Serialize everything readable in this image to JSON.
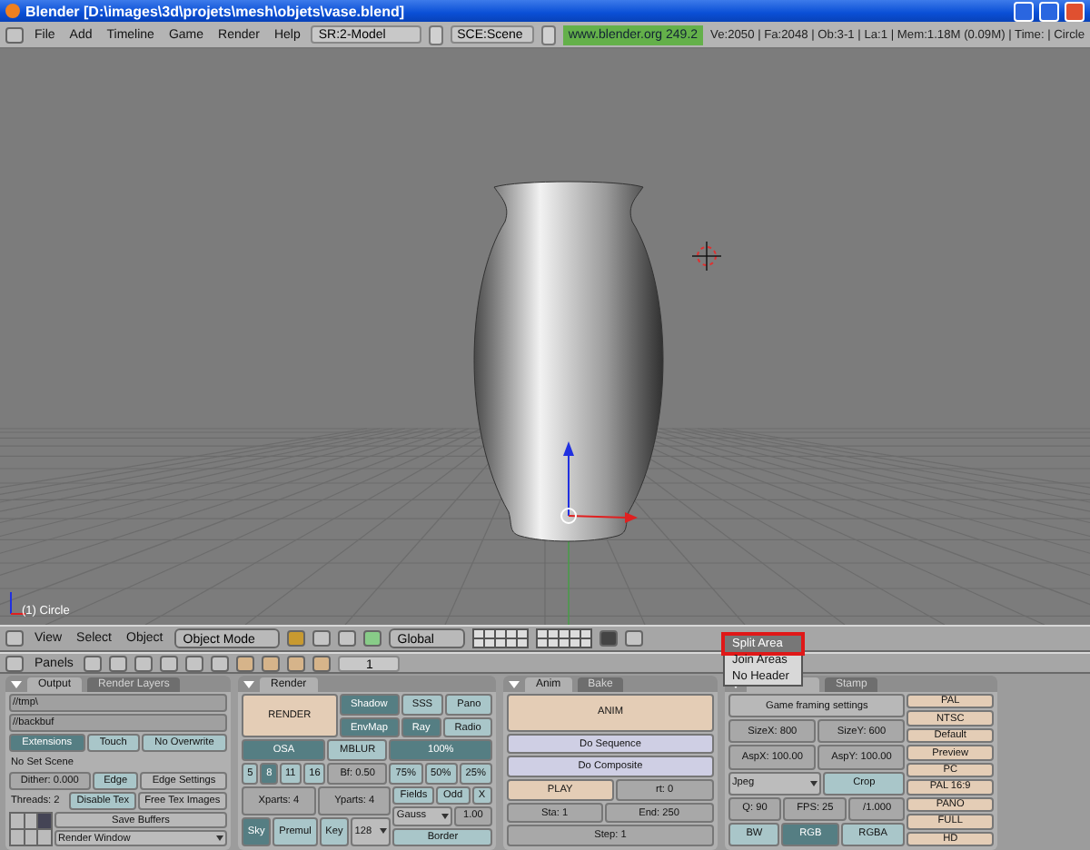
{
  "window": {
    "title": "Blender [D:\\images\\3d\\projets\\mesh\\objets\\vase.blend]"
  },
  "menu_bar": {
    "menus": [
      "File",
      "Add",
      "Timeline",
      "Game",
      "Render",
      "Help"
    ],
    "screen": "SR:2-Model",
    "scene": "SCE:Scene",
    "version": "www.blender.org 249.2",
    "stats": "Ve:2050 | Fa:2048 | Ob:3-1 | La:1 | Mem:1.18M (0.09M) | Time: | Circle"
  },
  "viewport": {
    "object_label": "(1) Circle"
  },
  "view_header": {
    "menus": [
      "View",
      "Select",
      "Object"
    ],
    "mode": "Object Mode",
    "orientation": "Global"
  },
  "buttons_header": {
    "label": "Panels",
    "frame": "1"
  },
  "context_menu": {
    "items": [
      {
        "label": "Split Area",
        "selected": true
      },
      {
        "label": "Join Areas",
        "selected": false
      },
      {
        "label": "No Header",
        "selected": false
      }
    ]
  },
  "panels": [
    {
      "tabs": [
        {
          "label": "Output",
          "selected": true
        },
        {
          "label": "Render Layers",
          "selected": false
        }
      ],
      "rows": [
        [
          {
            "kind": "field",
            "text": "//tmp\\"
          }
        ],
        [
          {
            "kind": "field",
            "text": "//backbuf"
          }
        ],
        [
          {
            "kind": "toggle",
            "text": "Extensions",
            "selected": true
          },
          {
            "kind": "toggle",
            "text": "Touch",
            "selected": false
          },
          {
            "kind": "toggle",
            "text": "No Overwrite",
            "selected": false
          }
        ],
        [
          {
            "kind": "label",
            "text": "No Set Scene"
          }
        ],
        [
          {
            "kind": "number",
            "text": "Dither: 0.000"
          },
          {
            "kind": "toggle",
            "text": "Edge",
            "selected": false
          },
          {
            "kind": "button",
            "text": "Edge Settings"
          }
        ],
        [
          {
            "kind": "label",
            "text": "Threads: 2"
          },
          {
            "kind": "toggle",
            "text": "Disable Tex",
            "selected": false
          },
          {
            "kind": "button",
            "text": "Free Tex Images"
          }
        ],
        [
          {
            "kind": "grid"
          },
          {
            "kind": "stack",
            "items": [
              {
                "kind": "button",
                "text": "Save Buffers"
              },
              {
                "kind": "menu",
                "text": "Render Window"
              }
            ]
          }
        ]
      ]
    },
    {
      "tabs": [
        {
          "label": "Render",
          "selected": true
        }
      ],
      "rows": [
        [
          {
            "kind": "big",
            "text": "RENDER"
          },
          {
            "kind": "stack",
            "items": [
              {
                "kind": "row",
                "items": [
                  {
                    "kind": "toggle",
                    "text": "Shadow",
                    "selected": true
                  },
                  {
                    "kind": "toggle",
                    "text": "SSS",
                    "selected": false
                  },
                  {
                    "kind": "toggle",
                    "text": "Pano",
                    "selected": false
                  }
                ]
              },
              {
                "kind": "row",
                "items": [
                  {
                    "kind": "toggle",
                    "text": "EnvMap",
                    "selected": true
                  },
                  {
                    "kind": "toggle",
                    "text": "Ray",
                    "selected": true
                  },
                  {
                    "kind": "toggle",
                    "text": "Radio",
                    "selected": false
                  }
                ]
              }
            ]
          }
        ],
        [
          {
            "kind": "stack",
            "items": [
              {
                "kind": "toggle",
                "text": "OSA",
                "selected": true
              },
              {
                "kind": "row",
                "items": [
                  {
                    "kind": "toggle",
                    "text": "5",
                    "selected": false
                  },
                  {
                    "kind": "toggle",
                    "text": "8",
                    "selected": true
                  },
                  {
                    "kind": "toggle",
                    "text": "11",
                    "selected": false
                  },
                  {
                    "kind": "toggle",
                    "text": "16",
                    "selected": false
                  }
                ]
              }
            ]
          },
          {
            "kind": "stack",
            "items": [
              {
                "kind": "toggle",
                "text": "MBLUR",
                "selected": false
              },
              {
                "kind": "number",
                "text": "Bf: 0.50"
              }
            ]
          },
          {
            "kind": "stack",
            "items": [
              {
                "kind": "toggle",
                "text": "100%",
                "selected": true
              },
              {
                "kind": "row",
                "items": [
                  {
                    "kind": "toggle",
                    "text": "75%",
                    "selected": false
                  },
                  {
                    "kind": "toggle",
                    "text": "50%",
                    "selected": false
                  },
                  {
                    "kind": "toggle",
                    "text": "25%",
                    "selected": false
                  }
                ]
              }
            ]
          }
        ],
        [
          {
            "kind": "stack",
            "items": [
              {
                "kind": "row",
                "items": [
                  {
                    "kind": "number",
                    "text": "Xparts: 4"
                  },
                  {
                    "kind": "number",
                    "text": "Yparts: 4"
                  }
                ]
              },
              {
                "kind": "row",
                "items": [
                  {
                    "kind": "toggle",
                    "text": "Sky",
                    "selected": true
                  },
                  {
                    "kind": "toggle",
                    "text": "Premul",
                    "selected": false
                  },
                  {
                    "kind": "toggle",
                    "text": "Key",
                    "selected": false
                  },
                  {
                    "kind": "menu",
                    "text": "128"
                  }
                ]
              }
            ]
          },
          {
            "kind": "stack",
            "items": [
              {
                "kind": "row",
                "items": [
                  {
                    "kind": "toggle",
                    "text": "Fields",
                    "selected": false
                  },
                  {
                    "kind": "toggle",
                    "text": "Odd",
                    "selected": false
                  },
                  {
                    "kind": "toggle",
                    "text": "X",
                    "selected": false
                  }
                ]
              },
              {
                "kind": "row",
                "items": [
                  {
                    "kind": "menu",
                    "text": "Gauss"
                  },
                  {
                    "kind": "number",
                    "text": "1.00"
                  }
                ]
              },
              {
                "kind": "toggle",
                "text": "Border",
                "selected": false
              }
            ]
          }
        ]
      ]
    },
    {
      "tabs": [
        {
          "label": "Anim",
          "selected": true
        },
        {
          "label": "Bake",
          "selected": false
        }
      ],
      "rows": [
        [
          {
            "kind": "big",
            "text": "ANIM"
          }
        ],
        [
          {
            "kind": "seq",
            "text": "Do Sequence"
          }
        ],
        [
          {
            "kind": "seq",
            "text": "Do Composite"
          }
        ],
        [
          {
            "kind": "action",
            "text": "PLAY"
          },
          {
            "kind": "number",
            "text": "rt: 0"
          }
        ],
        [
          {
            "kind": "number",
            "text": "Sta: 1"
          },
          {
            "kind": "number",
            "text": "End: 250"
          }
        ],
        [
          {
            "kind": "number",
            "text": "Step: 1"
          }
        ]
      ]
    },
    {
      "tabs": [
        {
          "label": "Stamp",
          "selected": false
        }
      ],
      "rows": [
        [
          {
            "kind": "stack",
            "items": [
              {
                "kind": "button",
                "text": "Game framing settings"
              },
              {
                "kind": "row",
                "items": [
                  {
                    "kind": "number",
                    "text": "SizeX: 800"
                  },
                  {
                    "kind": "number",
                    "text": "SizeY: 600"
                  }
                ]
              },
              {
                "kind": "row",
                "items": [
                  {
                    "kind": "number",
                    "text": "AspX: 100.00"
                  },
                  {
                    "kind": "number",
                    "text": "AspY: 100.00"
                  }
                ]
              },
              {
                "kind": "row",
                "items": [
                  {
                    "kind": "menu",
                    "text": "Jpeg"
                  },
                  {
                    "kind": "toggle",
                    "text": "Crop",
                    "selected": false
                  }
                ]
              },
              {
                "kind": "row",
                "items": [
                  {
                    "kind": "number",
                    "text": "Q: 90"
                  },
                  {
                    "kind": "number",
                    "text": "FPS: 25"
                  },
                  {
                    "kind": "number",
                    "text": "/1.000"
                  }
                ]
              },
              {
                "kind": "row",
                "items": [
                  {
                    "kind": "toggle",
                    "text": "BW",
                    "selected": false
                  },
                  {
                    "kind": "toggle",
                    "text": "RGB",
                    "selected": true
                  },
                  {
                    "kind": "toggle",
                    "text": "RGBA",
                    "selected": false
                  }
                ]
              }
            ]
          },
          {
            "kind": "stack",
            "items": [
              {
                "kind": "action",
                "text": "PAL"
              },
              {
                "kind": "action",
                "text": "NTSC"
              },
              {
                "kind": "action",
                "text": "Default"
              },
              {
                "kind": "action",
                "text": "Preview"
              },
              {
                "kind": "action",
                "text": "PC"
              },
              {
                "kind": "action",
                "text": "PAL 16:9"
              },
              {
                "kind": "action",
                "text": "PANO"
              },
              {
                "kind": "action",
                "text": "FULL"
              },
              {
                "kind": "action",
                "text": "HD"
              }
            ]
          }
        ]
      ]
    }
  ]
}
